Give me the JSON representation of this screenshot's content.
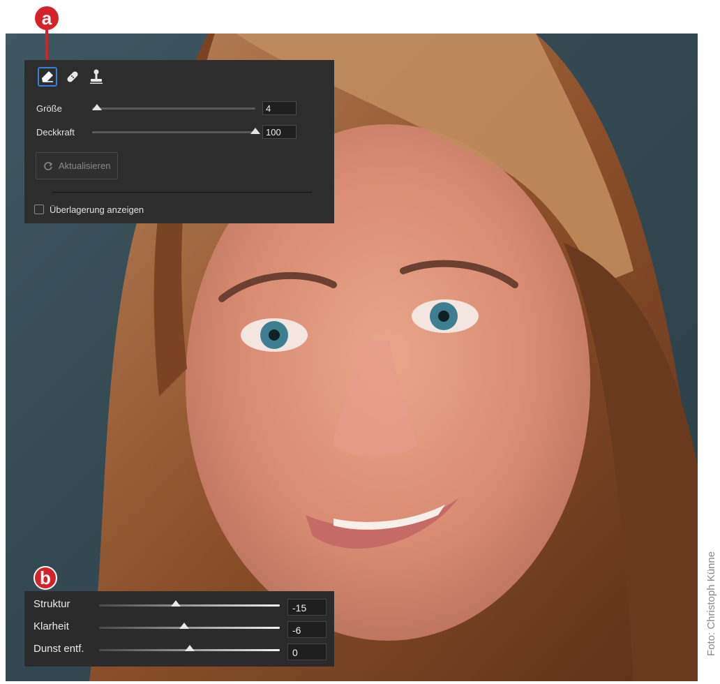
{
  "badges": {
    "a": "a",
    "b": "b"
  },
  "top_panel": {
    "tools": [
      "eraser-icon",
      "bandage-icon",
      "stamp-icon"
    ],
    "size_label": "Größe",
    "size_value": "4",
    "size_level": 0.03,
    "opacity_label": "Deckkraft",
    "opacity_value": "100",
    "opacity_level": 1.0,
    "update_button": "Aktualisieren",
    "overlay_label": "Überlagerung anzeigen"
  },
  "bottom_panel": {
    "sliders": [
      {
        "label": "Struktur",
        "value": "-15"
      },
      {
        "label": "Klarheit",
        "value": "-6"
      },
      {
        "label": "Dunst entf.",
        "value": "0"
      }
    ]
  },
  "credit": "Foto: Christoph Künne",
  "colors": {
    "accent": "#d2232a",
    "selection": "#3b7fd6"
  }
}
